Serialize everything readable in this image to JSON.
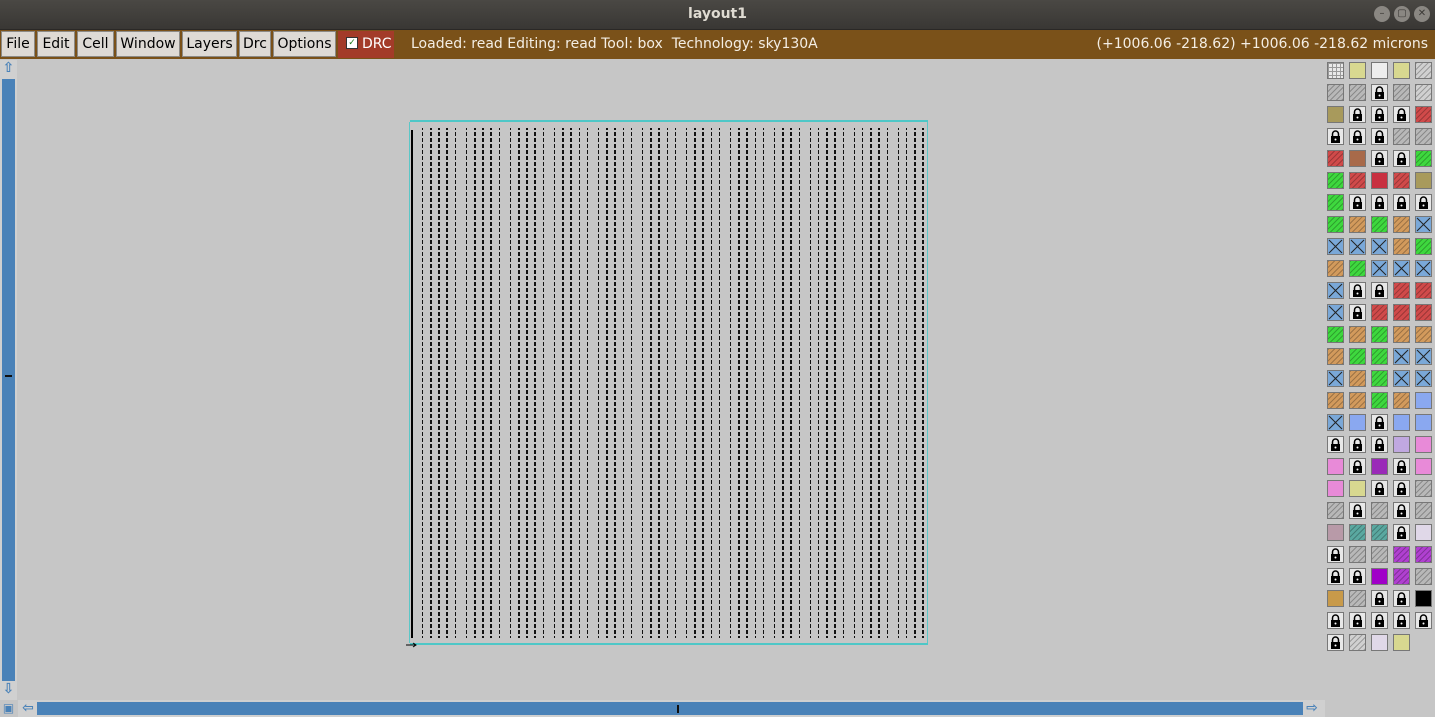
{
  "window": {
    "title": "layout1"
  },
  "menu": {
    "items": [
      "File",
      "Edit",
      "Cell",
      "Window",
      "Layers",
      "Drc",
      "Options"
    ],
    "drc_toggle": {
      "label": "DRC",
      "checked": true
    }
  },
  "status": {
    "text": "Loaded: read Editing: read Tool: box  Technology: sky130A",
    "coords": "(+1006.06 -218.62) +1006.06 -218.62 microns"
  },
  "colors": {
    "menubar": "#7a5119",
    "drc": "#a33b29",
    "scroll": "#4a82b8",
    "wire": "#111111",
    "grid_cyan": "#2fc7c7"
  },
  "icons": {
    "up": "arrow-up-icon",
    "down": "arrow-down-icon",
    "left": "arrow-left-icon",
    "right": "arrow-right-icon",
    "lock": "lock-icon"
  },
  "layout": {
    "pattern": "vertical dotted rails",
    "rail_count": 58
  },
  "palette": [
    [
      "grid",
      "yellow",
      "box",
      "yellow",
      "hatch"
    ],
    [
      "gray",
      "gray",
      "lock",
      "gray",
      "hatch"
    ],
    [
      "olive",
      "lock",
      "lock",
      "lock",
      "red"
    ],
    [
      "lock",
      "lock",
      "lock",
      "gray",
      "gray"
    ],
    [
      "red",
      "brown",
      "lock",
      "lock",
      "green"
    ],
    [
      "green",
      "red",
      "crimson",
      "red",
      "olive"
    ],
    [
      "green",
      "lock",
      "lock",
      "lock",
      "lock"
    ],
    [
      "green",
      "tan",
      "green",
      "tan",
      "cross"
    ],
    [
      "cross",
      "cross",
      "cross",
      "tan",
      "green"
    ],
    [
      "tan",
      "green",
      "cross",
      "cross",
      "cross"
    ],
    [
      "cross",
      "lock",
      "lock",
      "red",
      "red"
    ],
    [
      "cross",
      "lock",
      "red",
      "red",
      "red"
    ],
    [
      "green",
      "tan",
      "green",
      "tan",
      "tan"
    ],
    [
      "tan",
      "green",
      "green",
      "cross",
      "cross"
    ],
    [
      "cross",
      "tan",
      "green",
      "cross",
      "cross"
    ],
    [
      "tan",
      "tan",
      "green",
      "tan",
      "blue"
    ],
    [
      "cross",
      "blue",
      "lock",
      "blue",
      "blue"
    ],
    [
      "lock",
      "lock",
      "lock",
      "lavender",
      "pink"
    ],
    [
      "pink",
      "lock",
      "purple",
      "lock",
      "pink"
    ],
    [
      "pink",
      "yellow",
      "lock",
      "lock",
      "gray"
    ],
    [
      "gray",
      "lock",
      "gray",
      "lock",
      "gray"
    ],
    [
      "mauve",
      "teal",
      "teal",
      "lock",
      "dots"
    ],
    [
      "lock",
      "gray",
      "gray",
      "violet",
      "violet"
    ],
    [
      "lock",
      "lock",
      "magenta",
      "violet",
      "gray"
    ],
    [
      "orange",
      "gray",
      "lock",
      "lock",
      "black"
    ],
    [
      "lock",
      "lock",
      "lock",
      "lock",
      "lock"
    ],
    [
      "lock",
      "hatch",
      "dots",
      "yellow",
      ""
    ]
  ]
}
